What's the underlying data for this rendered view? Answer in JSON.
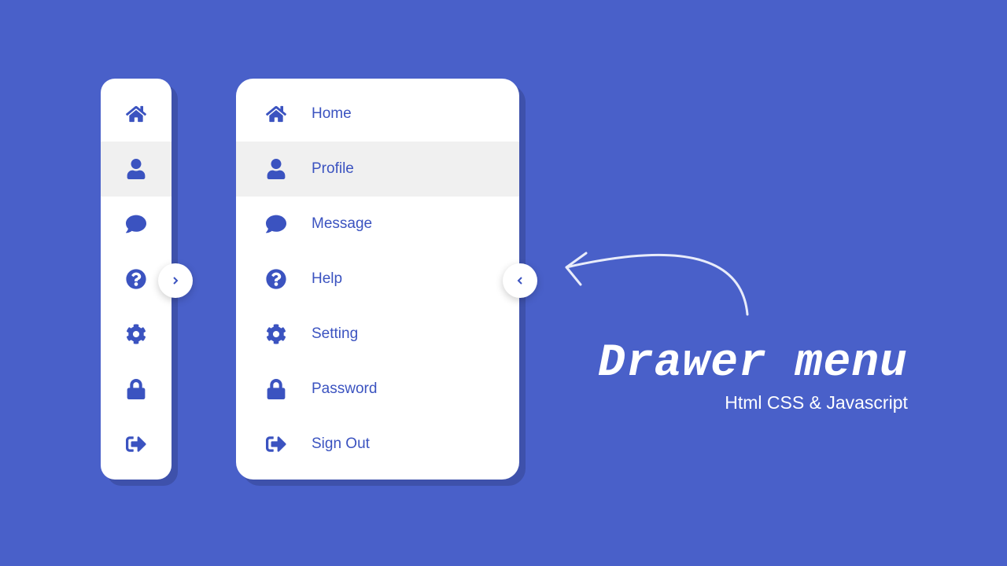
{
  "menu": {
    "items": [
      {
        "label": "Home",
        "icon": "home-icon",
        "active": false
      },
      {
        "label": "Profile",
        "icon": "user-icon",
        "active": true
      },
      {
        "label": "Message",
        "icon": "message-icon",
        "active": false
      },
      {
        "label": "Help",
        "icon": "help-icon",
        "active": false
      },
      {
        "label": "Setting",
        "icon": "gear-icon",
        "active": false
      },
      {
        "label": "Password",
        "icon": "lock-icon",
        "active": false
      },
      {
        "label": "Sign Out",
        "icon": "signout-icon",
        "active": false
      }
    ]
  },
  "title": {
    "main": "Drawer menu",
    "sub": "Html CSS & Javascript"
  },
  "colors": {
    "background": "#4960c9",
    "accent": "#3b53c0",
    "panel": "#ffffff",
    "hover": "#f0f0f0"
  }
}
